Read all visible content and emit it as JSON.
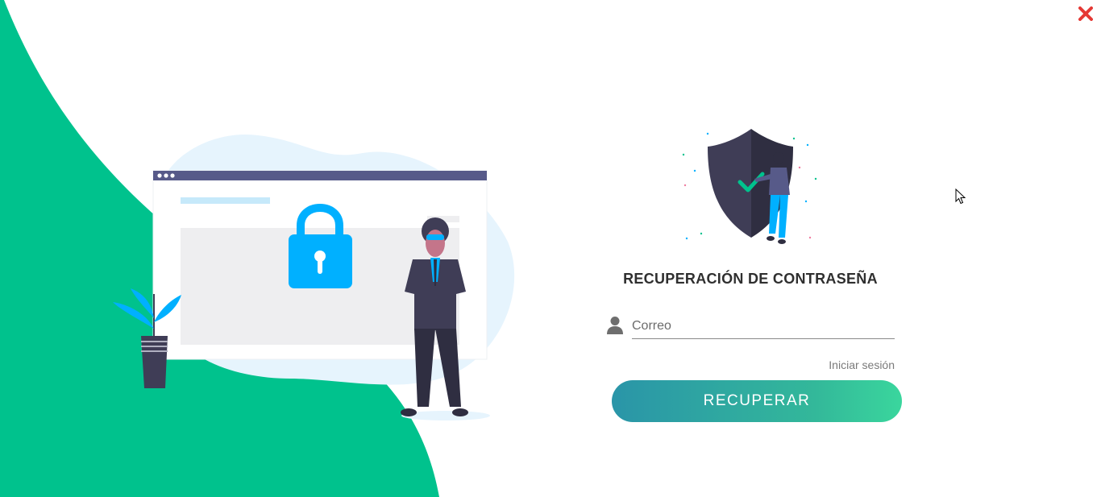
{
  "window": {
    "close_icon": "close-icon"
  },
  "form": {
    "title": "RECUPERACIÓN DE CONTRASEÑA",
    "email_placeholder": "Correo",
    "email_value": "",
    "user_icon": "user-icon",
    "login_link": "Iniciar sesión",
    "submit_label": "RECUPERAR"
  },
  "colors": {
    "brand_green": "#00c28d",
    "accent_blue": "#00b0ff",
    "close_red": "#e53935",
    "button_gradient_start": "#2a95a8",
    "button_gradient_end": "#3ad69d",
    "title_text": "#2f2f2f"
  }
}
